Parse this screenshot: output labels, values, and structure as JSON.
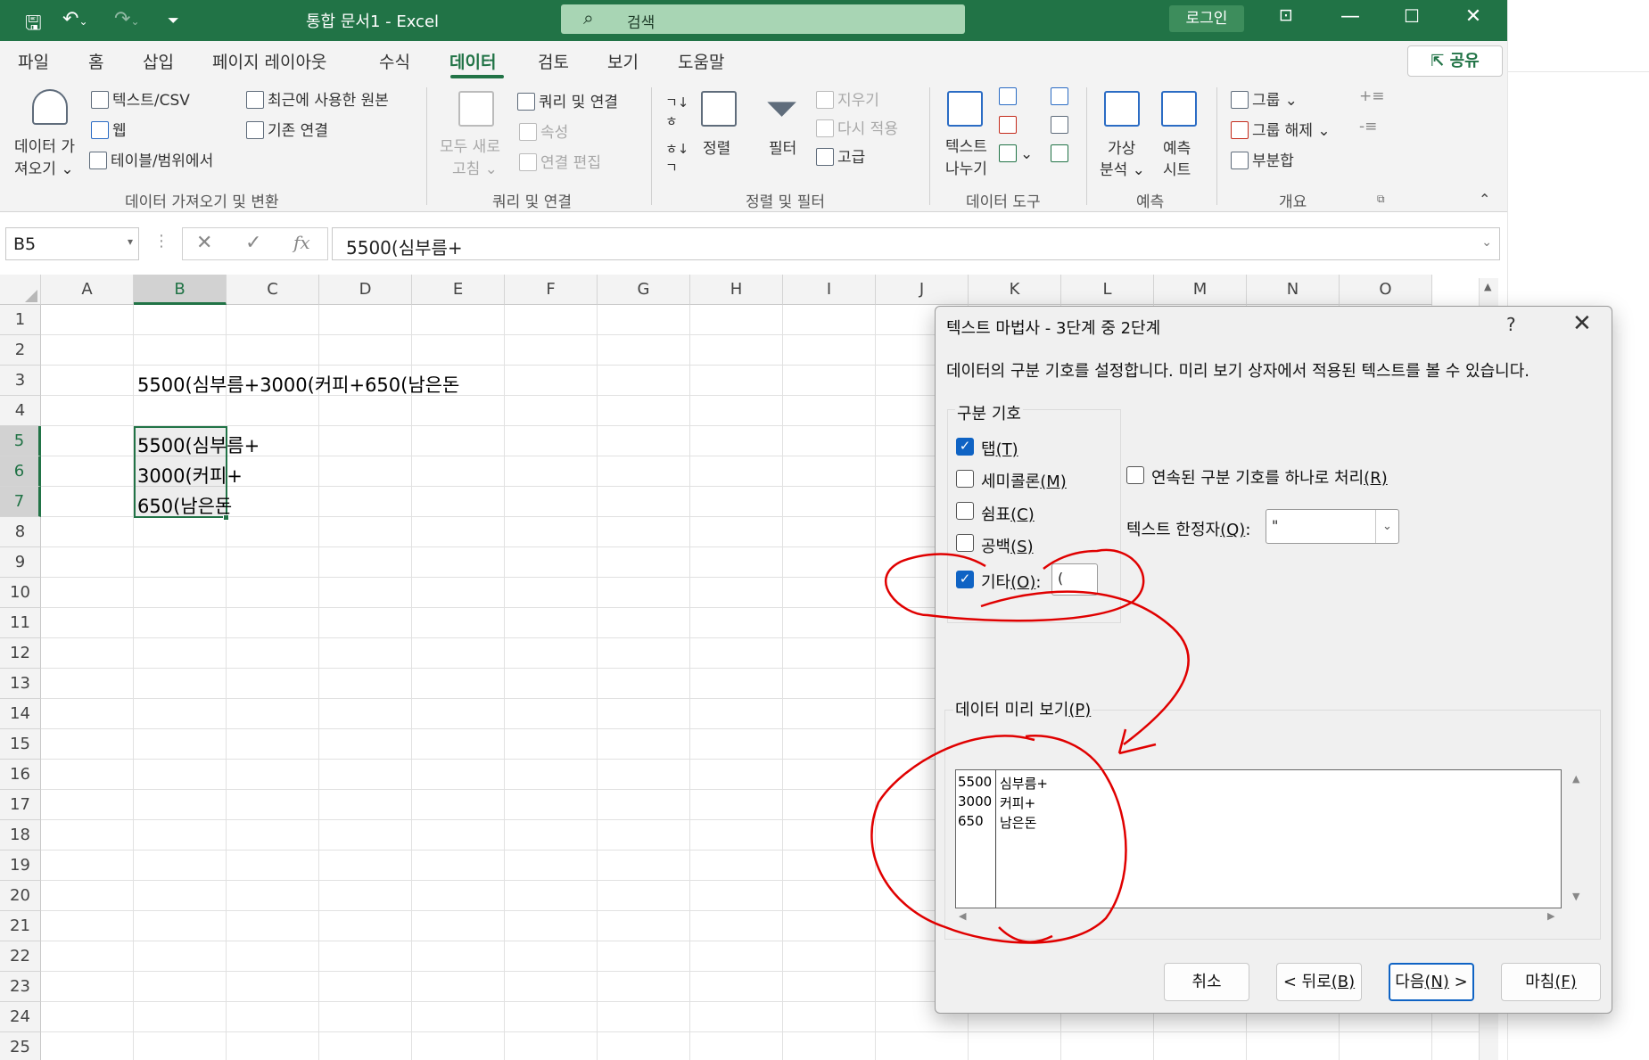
{
  "titlebar": {
    "doc_title": "통합 문서1  -  Excel",
    "search_placeholder": "검색",
    "login": "로그인"
  },
  "ribbon_tabs": [
    "파일",
    "홈",
    "삽입",
    "페이지 레이아웃",
    "수식",
    "데이터",
    "검토",
    "보기",
    "도움말"
  ],
  "share": "공유",
  "ribbon": {
    "get_data": [
      "데이터 가",
      "져오기"
    ],
    "text_csv": "텍스트/CSV",
    "web": "웹",
    "from_table": "테이블/범위에서",
    "recent_sources": "최근에 사용한 원본",
    "existing_conn": "기존 연결",
    "group1": "데이터 가져오기 및 변환",
    "refresh_all": [
      "모두 새로",
      "고침"
    ],
    "queries_conn": "쿼리 및 연결",
    "properties": "속성",
    "edit_links": "연결 편집",
    "group2": "쿼리 및 연결",
    "sort": "정렬",
    "filter": "필터",
    "clear": "지우기",
    "reapply": "다시 적용",
    "advanced": "고급",
    "group3": "정렬 및 필터",
    "text_to_columns": [
      "텍스트",
      "나누기"
    ],
    "group4": "데이터 도구",
    "whatif": [
      "가상",
      "분석"
    ],
    "forecast_sheet": [
      "예측",
      "시트"
    ],
    "group5": "예측",
    "group_btn": "그룹",
    "ungroup_btn": "그룹 해제",
    "subtotal": "부분합",
    "group6": "개요"
  },
  "formula_bar": {
    "name_box": "B5",
    "formula": "5500(심부름+"
  },
  "grid": {
    "columns": [
      "A",
      "B",
      "C",
      "D",
      "E",
      "F",
      "G",
      "H",
      "I",
      "J",
      "K",
      "L",
      "M",
      "N",
      "O"
    ],
    "rows": [
      "1",
      "2",
      "3",
      "4",
      "5",
      "6",
      "7",
      "8",
      "9",
      "10",
      "11",
      "12",
      "13",
      "14",
      "15",
      "16",
      "17",
      "18",
      "19",
      "20",
      "21",
      "22",
      "23",
      "24",
      "25"
    ],
    "cells": {
      "B3": "5500(심부름+3000(커피+650(남은돈",
      "B5": "5500(심부름+",
      "B6": "3000(커피+",
      "B7": "650(남은돈"
    }
  },
  "dialog": {
    "title": "텍스트 마법사 - 3단계 중 2단계",
    "help": "?",
    "description": "데이터의 구분 기호를 설정합니다. 미리 보기 상자에서 적용된 텍스트를 볼 수 있습니다.",
    "delimiters_label": "구분 기호",
    "tab": {
      "label": "탭",
      "key": "(T)",
      "checked": true
    },
    "semicolon": {
      "label": "세미콜론",
      "key": "(M)",
      "checked": false
    },
    "comma": {
      "label": "쉼표",
      "key": "(C)",
      "checked": false
    },
    "space": {
      "label": "공백",
      "key": "(S)",
      "checked": false
    },
    "other": {
      "label": "기타",
      "key": "(O)",
      "checked": true,
      "value": "("
    },
    "consecutive": {
      "label": "연속된 구분 기호를 하나로 처리",
      "key": "(R)",
      "checked": false
    },
    "qualifier_label": "텍스트 한정자",
    "qualifier_key": "(Q)",
    "qualifier_value": "\"",
    "preview_label": "데이터 미리 보기",
    "preview_key": "(P)",
    "preview_rows": [
      [
        "5500",
        "심부름+"
      ],
      [
        "3000",
        "커피+"
      ],
      [
        "650",
        "남은돈"
      ]
    ],
    "buttons": {
      "cancel": "취소",
      "back": "< 뒤로",
      "back_key": "(B)",
      "next": "다음",
      "next_key": "(N)",
      "next_suffix": " >",
      "finish": "마침",
      "finish_key": "(F)"
    }
  },
  "colors": {
    "excel_green": "#217346",
    "annotation_red": "#e00000",
    "checkbox_blue": "#0f63c4"
  }
}
